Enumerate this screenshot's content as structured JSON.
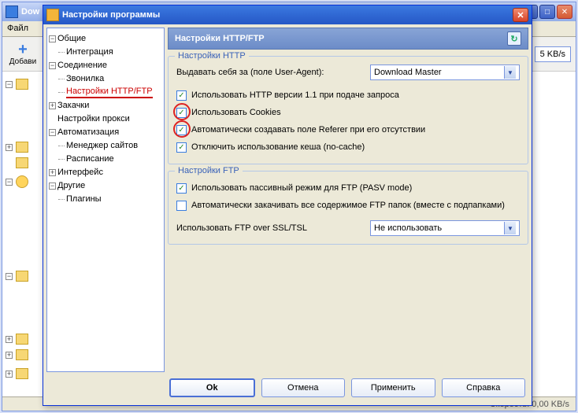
{
  "bg": {
    "title": "Dow",
    "menu_file": "Файл",
    "toolbar_add": "Добави",
    "speed": "5 KB/s",
    "status_left": "",
    "status_right": "Скорость: 0,00 KB/s"
  },
  "dialog": {
    "title": "Настройки программы",
    "tree": {
      "general": "Общие",
      "integration": "Интеграция",
      "connection": "Соединение",
      "dialer": "Звонилка",
      "http_ftp": "Настройки HTTP/FTP",
      "downloads": "Закачки",
      "proxy": "Настройки прокси",
      "automation": "Автоматизация",
      "site_manager": "Менеджер сайтов",
      "schedule": "Расписание",
      "interface": "Интерфейс",
      "other": "Другие",
      "plugins": "Плагины"
    },
    "section_title": "Настройки HTTP/FTP",
    "http": {
      "legend": "Настройки HTTP",
      "ua_label": "Выдавать себя за (поле User-Agent):",
      "ua_value": "Download Master",
      "chk_http11": "Использовать HTTP версии 1.1 при подаче запроса",
      "chk_cookies": "Использовать Cookies",
      "chk_referer": "Автоматически создавать поле Referer при его отсутствии",
      "chk_nocache": "Отключить использование кеша (no-cache)"
    },
    "ftp": {
      "legend": "Настройки FTP",
      "chk_pasv": "Использовать пассивный режим для FTP (PASV mode)",
      "chk_recursive": "Автоматически закачивать все содержимое FTP папок (вместе с подпапками)",
      "ssl_label": "Использовать FTP over SSL/TSL",
      "ssl_value": "Не использовать"
    },
    "buttons": {
      "ok": "Ok",
      "cancel": "Отмена",
      "apply": "Применить",
      "help": "Справка"
    }
  }
}
